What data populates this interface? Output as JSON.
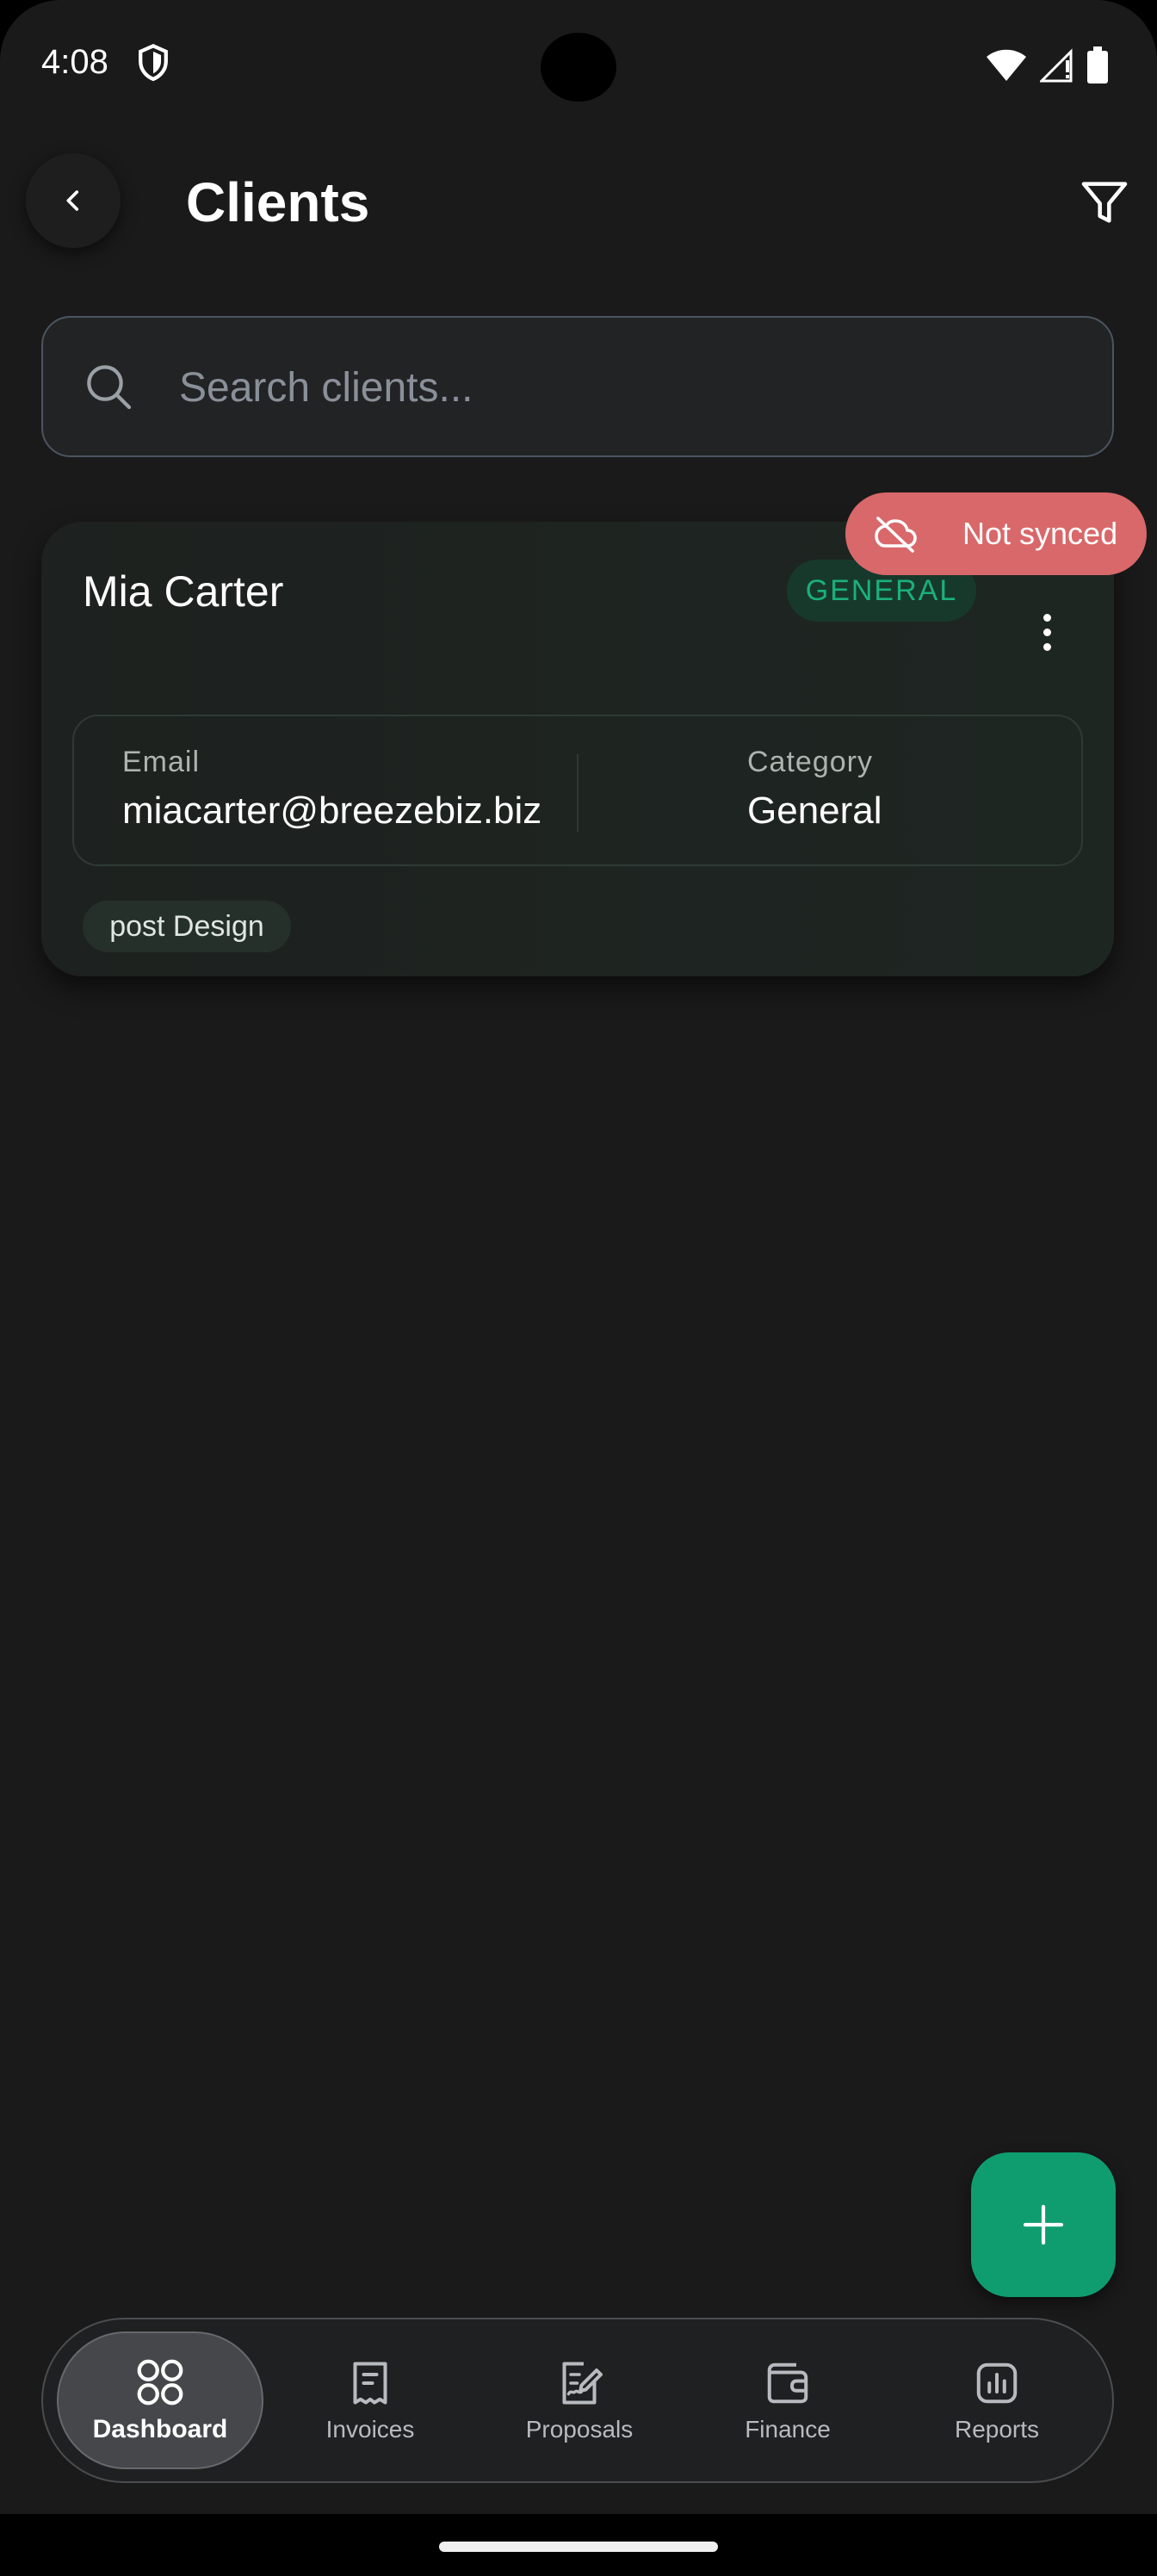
{
  "status_bar": {
    "time": "4:08"
  },
  "header": {
    "title": "Clients"
  },
  "search": {
    "placeholder": "Search clients..."
  },
  "client": {
    "name": "Mia Carter",
    "badge": "GENERAL",
    "email_label": "Email",
    "email": "miacarter@breezebiz.biz",
    "category_label": "Category",
    "category": "General",
    "tag": "post Design"
  },
  "sync_status": {
    "label": "Not synced",
    "color": "#d9686a"
  },
  "nav": {
    "items": [
      {
        "label": "Dashboard",
        "icon": "dashboard-icon",
        "active": true
      },
      {
        "label": "Invoices",
        "icon": "receipt-icon"
      },
      {
        "label": "Proposals",
        "icon": "edit-document-icon"
      },
      {
        "label": "Finance",
        "icon": "wallet-icon"
      },
      {
        "label": "Reports",
        "icon": "bar-chart-icon"
      }
    ]
  },
  "colors": {
    "background": "#1a1a1a",
    "accent": "#0f9d6f",
    "badge_text": "#1bb07a",
    "error": "#d9686a"
  }
}
